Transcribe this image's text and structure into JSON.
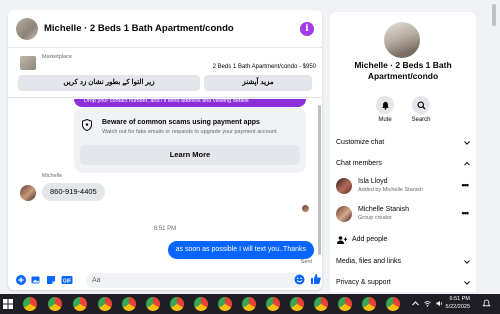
{
  "chat": {
    "title": "Michelle · 2 Beds 1 Bath Apartment/condo",
    "info_icon": "i",
    "marketplace": {
      "label": "Marketplace",
      "listing": "2 Beds 1 Bath Apartment/condo - $950",
      "button_left": "زیر التوا کے بطور نشان زد کریں",
      "button_right": "مزید آپشنز"
    },
    "warning": {
      "banner_text": "Drop your contact number, and I'll send address and viewing details",
      "title": "Beware of common scams using payment apps",
      "subtitle": "Watch out for fake emails or requests to upgrade your payment account.",
      "button": "Learn More"
    },
    "messages": {
      "sender": "Michelle",
      "incoming": "860-919-4405",
      "time": "6:51 PM",
      "outgoing": "as soon as possible I will text you..Thanks",
      "status": "Sent"
    },
    "composer": {
      "placeholder": "Aa"
    }
  },
  "info": {
    "title": "Michelle · 2 Beds 1 Bath Apartment/condo",
    "actions": {
      "mute": "Mute",
      "search": "Search"
    },
    "customize": "Customize chat",
    "members_header": "Chat members",
    "members": [
      {
        "name": "Isla Lloyd",
        "sub": "Added by Michelle Stanish"
      },
      {
        "name": "Michelle Stanish",
        "sub": "Group creator"
      }
    ],
    "add_people": "Add people",
    "media": "Media, files and links",
    "privacy": "Privacy & support"
  },
  "taskbar": {
    "time": "6:51 PM",
    "date": "5/22/2025"
  },
  "colors": {
    "messenger_blue": "#0866ff",
    "purple": "#8a2fd9",
    "taskbar": "#1e1e24"
  }
}
